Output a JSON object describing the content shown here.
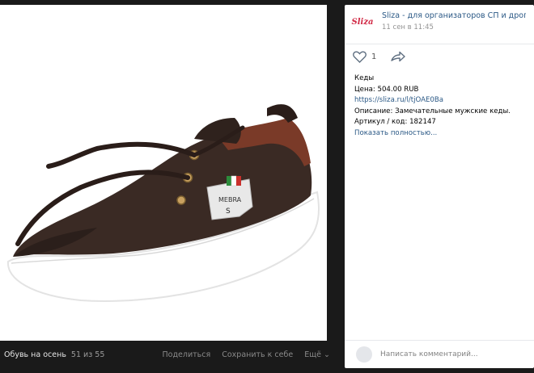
{
  "viewer": {
    "album_title": "Обувь на осень",
    "counter": "51 из 55",
    "actions": {
      "share": "Поделиться",
      "save": "Сохранить к себе",
      "more": "Ещё ⌄"
    }
  },
  "post": {
    "logo_text": "Sliza",
    "group_name": "Sliza - для организаторов СП и дроп",
    "date": "11 сен в 11:45",
    "likes": "1",
    "lines": {
      "title": "Кеды",
      "price": "Цена: 504.00 RUB",
      "link": "https://sliza.ru/l/tjOAE0Ba",
      "description": "Описание: Замечательные мужские кеды.",
      "article": "Артикул / код: 182147",
      "show_more": "Показать полностью..."
    }
  },
  "comment": {
    "placeholder": "Написать комментарий..."
  },
  "tag": {
    "brand": "MEBRA",
    "size": "S"
  },
  "colors": {
    "shoe_body": "#3a2a24",
    "collar_leather": "#7a3a28",
    "sole": "#ffffff",
    "link": "#2a5885"
  }
}
